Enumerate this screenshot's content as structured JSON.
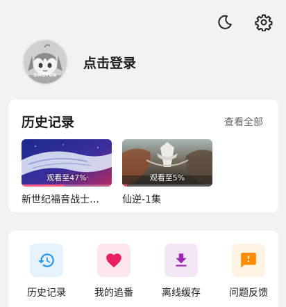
{
  "header": {
    "icons": [
      "moon-icon",
      "gear-icon"
    ]
  },
  "profile": {
    "avatar_brand": "OMOFUN",
    "login_label": "点击登录"
  },
  "history": {
    "title": "历史记录",
    "see_all_label": "查看全部",
    "items": [
      {
        "title": "新世纪福音战士…",
        "watch_label": "观看至47%",
        "progress": 0.47
      },
      {
        "title": "仙逆-1集",
        "watch_label": "观看至5%",
        "progress": 0.05
      }
    ]
  },
  "menu": {
    "items": [
      {
        "label": "历史记录",
        "icon": "history-icon",
        "bg": "#e6f3fd",
        "color": "#2196f3"
      },
      {
        "label": "我的追番",
        "icon": "heart-icon",
        "bg": "#fde7ee",
        "color": "#e91e63"
      },
      {
        "label": "离线缓存",
        "icon": "download-icon",
        "bg": "#f3e7f6",
        "color": "#9c27b0"
      },
      {
        "label": "问题反馈",
        "icon": "feedback-icon",
        "bg": "#fff3e3",
        "color": "#fb8c00"
      }
    ]
  }
}
